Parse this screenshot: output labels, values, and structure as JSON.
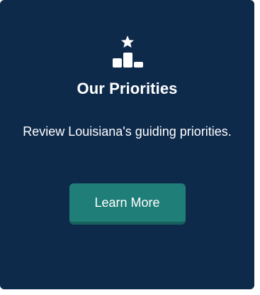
{
  "card": {
    "icon": "podium-star-icon",
    "title": "Our Priorities",
    "description": "Review Louisiana's guiding priorities.",
    "button_label": "Learn More"
  },
  "colors": {
    "card_background": "#0e2a4b",
    "button_background": "#1f7e78",
    "text": "#ffffff"
  }
}
